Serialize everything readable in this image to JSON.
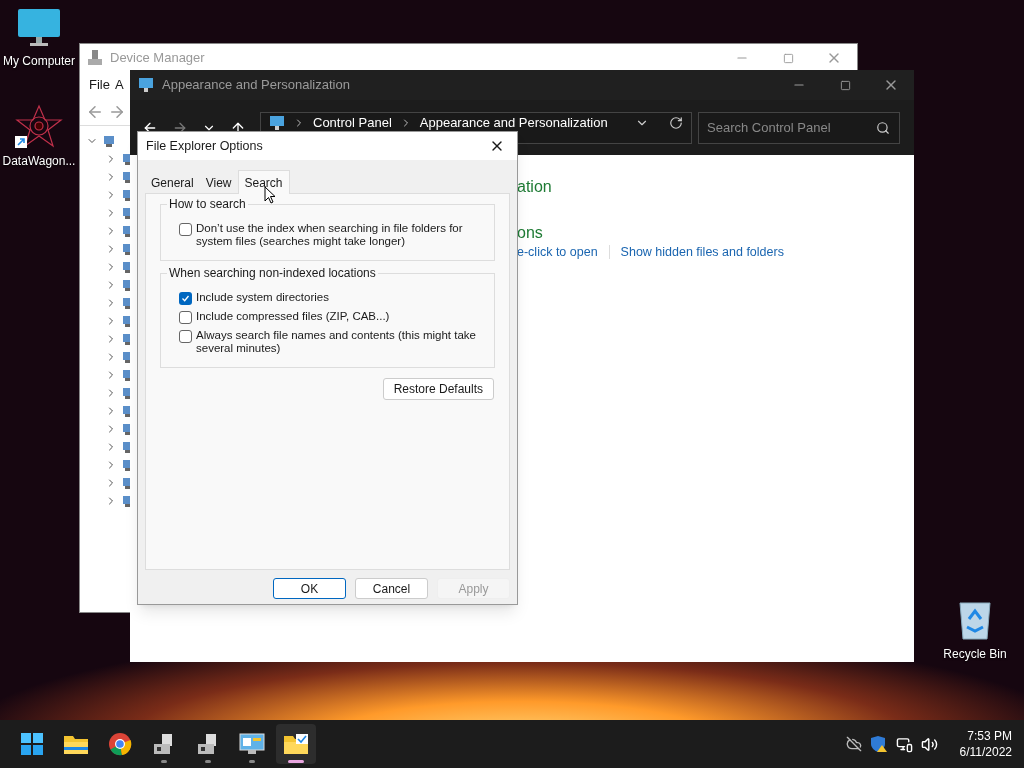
{
  "desktop_icons": [
    {
      "kind": "computer",
      "label": "My Computer"
    },
    {
      "kind": "shortcut",
      "label": "DataWagon..."
    },
    {
      "kind": "recycle_bin",
      "label": "Recycle Bin"
    }
  ],
  "device_manager": {
    "title": "Device Manager",
    "menu": [
      "File",
      "A"
    ],
    "tree": [
      {
        "expanded": true,
        "children": [
          {
            "expanded": false
          },
          {
            "expanded": false
          },
          {
            "expanded": false
          },
          {
            "expanded": false
          },
          {
            "expanded": false
          },
          {
            "expanded": false
          },
          {
            "expanded": false
          },
          {
            "expanded": false
          },
          {
            "expanded": false
          },
          {
            "expanded": false
          },
          {
            "expanded": false
          },
          {
            "expanded": false
          },
          {
            "expanded": false
          },
          {
            "expanded": false
          },
          {
            "expanded": false
          },
          {
            "expanded": false
          },
          {
            "expanded": false
          },
          {
            "expanded": false
          },
          {
            "expanded": false
          },
          {
            "expanded": false
          }
        ]
      }
    ]
  },
  "control_panel": {
    "title": "Appearance and Personalization",
    "breadcrumb": [
      "Control Panel",
      "Appearance and Personalization"
    ],
    "search": {
      "placeholder": "Search Control Panel"
    },
    "heading": "ation",
    "subheading": "ons",
    "links": [
      "e-click to open",
      "Show hidden files and folders"
    ]
  },
  "dialog": {
    "title": "File Explorer Options",
    "tabs": [
      {
        "label": "General",
        "selected": false
      },
      {
        "label": "View",
        "selected": false
      },
      {
        "label": "Search",
        "selected": true
      }
    ],
    "groups": [
      {
        "title": "How to search",
        "options": [
          {
            "label": "Don’t use the index when searching in file folders for system files (searches might take longer)",
            "checked": false
          }
        ]
      },
      {
        "title": "When searching non-indexed locations",
        "options": [
          {
            "label": "Include system directories",
            "checked": true
          },
          {
            "label": "Include compressed files (ZIP, CAB...)",
            "checked": false
          },
          {
            "label": "Always search file names and contents (this might take several minutes)",
            "checked": false
          }
        ]
      }
    ],
    "restore_button": "Restore Defaults",
    "buttons": [
      {
        "label": "OK",
        "default": true,
        "disabled": false
      },
      {
        "label": "Cancel",
        "default": false,
        "disabled": false
      },
      {
        "label": "Apply",
        "default": false,
        "disabled": true
      }
    ]
  },
  "taskbar": {
    "apps": [
      {
        "kind": "explorer",
        "running": false,
        "active": false
      },
      {
        "kind": "chrome",
        "running": false,
        "active": false
      },
      {
        "kind": "device",
        "running": true,
        "active": false
      },
      {
        "kind": "device",
        "running": true,
        "active": false
      },
      {
        "kind": "control_panel",
        "running": true,
        "active": false
      },
      {
        "kind": "folder_options",
        "running": true,
        "active": true
      }
    ],
    "time": "7:53 PM",
    "date": "6/11/2022"
  }
}
